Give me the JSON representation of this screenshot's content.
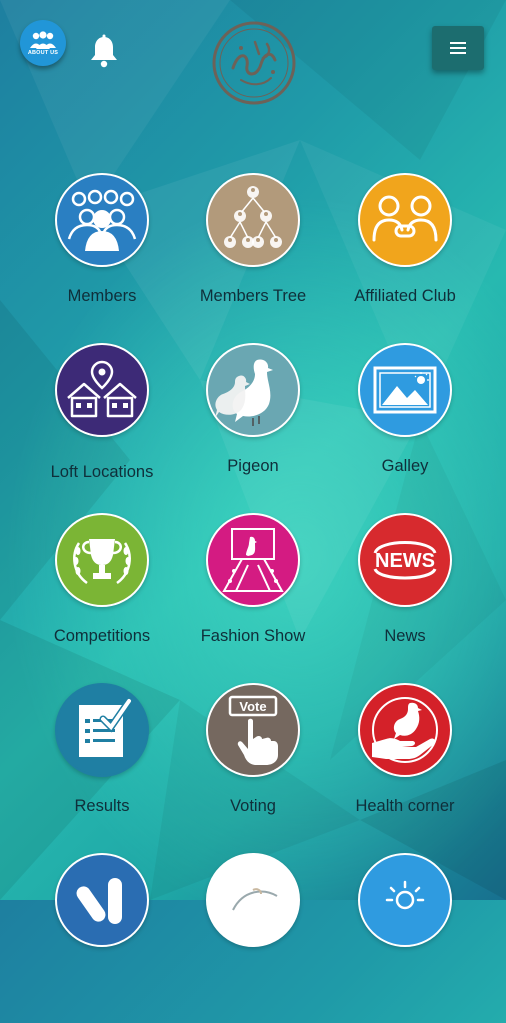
{
  "header": {
    "about_label": "ABOUT US",
    "about_icon": "users-group-icon",
    "notification_icon": "bell-icon",
    "logo_icon": "calligraphy-logo-icon",
    "menu_icon": "hamburger-menu-icon"
  },
  "colors": {
    "menu_button": "#1c6d6f",
    "about_button": "#2196d8",
    "members": "#2a7fc2",
    "members_tree": "#b29a7b",
    "affiliated_club": "#f1a51c",
    "loft_locations": "#3d2a77",
    "pigeon": "#6aa7b2",
    "galley": "#2f9be0",
    "competitions": "#7bb535",
    "fashion_show": "#d41b82",
    "news": "#d72a2e",
    "results": "#1f7fa3",
    "voting": "#75685f",
    "health_corner": "#d42129"
  },
  "menu_items": [
    {
      "label": "Members",
      "icon": "members-group-icon"
    },
    {
      "label": "Members Tree",
      "icon": "members-tree-icon"
    },
    {
      "label": "Affiliated Club",
      "icon": "affiliated-club-icon"
    },
    {
      "label": "Loft Locations",
      "icon": "loft-locations-icon"
    },
    {
      "label": "Pigeon",
      "icon": "pigeon-icon"
    },
    {
      "label": "Galley",
      "icon": "gallery-icon"
    },
    {
      "label": "Competitions",
      "icon": "trophy-icon"
    },
    {
      "label": "Fashion Show",
      "icon": "fashion-show-icon"
    },
    {
      "label": "News",
      "icon": "news-icon"
    },
    {
      "label": "Results",
      "icon": "results-checklist-icon"
    },
    {
      "label": "Voting",
      "icon": "voting-icon"
    },
    {
      "label": "Health corner",
      "icon": "health-corner-icon"
    }
  ],
  "news_badge": "NEWS",
  "vote_badge": "Vote"
}
